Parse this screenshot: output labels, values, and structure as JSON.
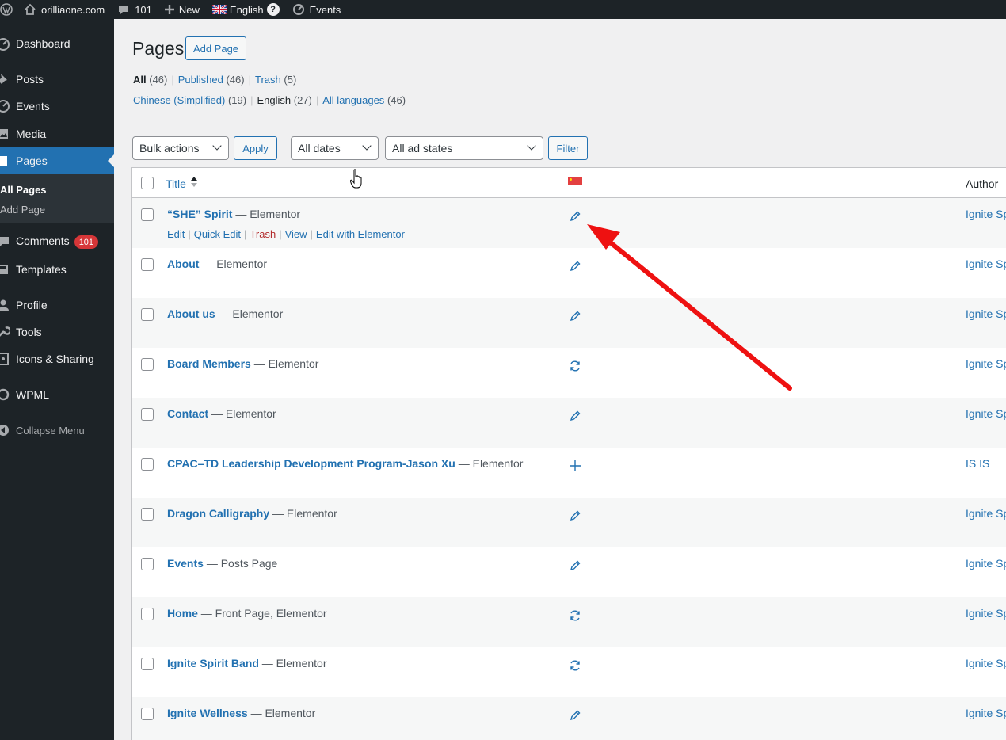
{
  "admin_bar": {
    "site_name": "orilliaone.com",
    "comments_count": "101",
    "new_label": "New",
    "language": "English",
    "help_symbol": "?",
    "events_label": "Events"
  },
  "sidebar": {
    "items": [
      {
        "label": "Dashboard",
        "icon": "dashboard-icon"
      },
      {
        "label": "Posts",
        "icon": "pin-icon"
      },
      {
        "label": "Events",
        "icon": "events-icon"
      },
      {
        "label": "Media",
        "icon": "media-icon"
      },
      {
        "label": "Pages",
        "icon": "page-icon"
      },
      {
        "label": "Comments",
        "icon": "comment-icon"
      },
      {
        "label": "Templates",
        "icon": "templates-icon"
      },
      {
        "label": "Profile",
        "icon": "user-icon"
      },
      {
        "label": "Tools",
        "icon": "wrench-icon"
      },
      {
        "label": "Icons & Sharing",
        "icon": "share-icon"
      },
      {
        "label": "WPML",
        "icon": "wpml-icon"
      }
    ],
    "submenu": [
      "All Pages",
      "Add Page"
    ],
    "comments_badge": "101",
    "collapse_label": "Collapse Menu"
  },
  "header": {
    "title": "Pages",
    "add_button": "Add Page"
  },
  "status_filters": {
    "all": "All",
    "all_count": "(46)",
    "published": "Published",
    "published_count": "(46)",
    "trash": "Trash",
    "trash_count": "(5)"
  },
  "language_filters": {
    "chinese": "Chinese (Simplified)",
    "chinese_count": "(19)",
    "english": "English",
    "english_count": "(27)",
    "all": "All languages",
    "all_count": "(46)"
  },
  "toolbar": {
    "bulk_actions": "Bulk actions",
    "apply": "Apply",
    "dates": "All dates",
    "ad_states": "All ad states",
    "filter": "Filter"
  },
  "table": {
    "col_title": "Title",
    "col_author": "Author",
    "row_actions": {
      "edit": "Edit",
      "quick_edit": "Quick Edit",
      "trash": "Trash",
      "view": "View",
      "edit_elementor": "Edit with Elementor"
    },
    "rows": [
      {
        "title": "“SHE” Spirit",
        "state": "— Elementor",
        "translation": "pencil",
        "author": "Ignite Sp"
      },
      {
        "title": "About",
        "state": "— Elementor",
        "translation": "pencil",
        "author": "Ignite Sp"
      },
      {
        "title": "About us",
        "state": "— Elementor",
        "translation": "pencil",
        "author": "Ignite Sp"
      },
      {
        "title": "Board Members",
        "state": "— Elementor",
        "translation": "sync",
        "author": "Ignite Sp"
      },
      {
        "title": "Contact",
        "state": "— Elementor",
        "translation": "pencil",
        "author": "Ignite Sp"
      },
      {
        "title": "CPAC–TD Leadership Development Program-Jason Xu",
        "state": "— Elementor",
        "translation": "plus",
        "author": "IS IS"
      },
      {
        "title": "Dragon Calligraphy",
        "state": "— Elementor",
        "translation": "pencil",
        "author": "Ignite Sp"
      },
      {
        "title": "Events",
        "state": "— Posts Page",
        "translation": "pencil",
        "author": "Ignite Sp"
      },
      {
        "title": "Home",
        "state": "— Front Page, Elementor",
        "translation": "sync",
        "author": "Ignite Sp"
      },
      {
        "title": "Ignite Spirit Band",
        "state": "— Elementor",
        "translation": "sync",
        "author": "Ignite Sp"
      },
      {
        "title": "Ignite Wellness",
        "state": "— Elementor",
        "translation": "pencil",
        "author": "Ignite Sp"
      }
    ]
  },
  "colors": {
    "accent": "#2271b1",
    "sidebar_bg": "#1d2327",
    "annotation_arrow": "#ee1111"
  }
}
